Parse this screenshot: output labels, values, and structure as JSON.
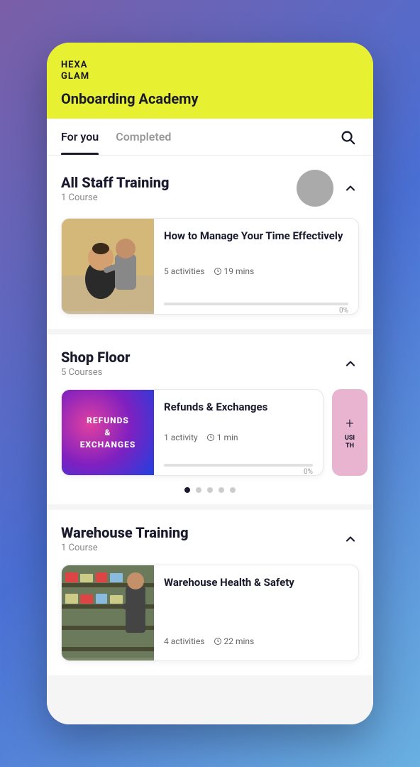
{
  "app": {
    "logo_line1": "HEXA",
    "logo_line2": "GLAM",
    "header_title": "Onboarding Academy"
  },
  "tabs": {
    "for_you": "For you",
    "completed": "Completed"
  },
  "sections": [
    {
      "id": "all-staff",
      "title": "All Staff Training",
      "subtitle": "1 Course",
      "show_avatar": true,
      "courses": [
        {
          "title": "How to Manage Your Time Effectively",
          "activities": "5 activities",
          "duration": "19 mins",
          "progress": 0,
          "thumb_type": "salon"
        }
      ]
    },
    {
      "id": "shop-floor",
      "title": "Shop Floor",
      "subtitle": "5 Courses",
      "show_avatar": false,
      "courses": [
        {
          "title": "Refunds & Exchanges",
          "activities": "1 activity",
          "duration": "1 min",
          "progress": 0,
          "thumb_type": "refunds",
          "thumb_text": "REFUNDS\n&\nEXCHANGES"
        }
      ],
      "carousel_dots": 5,
      "active_dot": 0
    },
    {
      "id": "warehouse",
      "title": "Warehouse Training",
      "subtitle": "1 Course",
      "show_avatar": false,
      "courses": [
        {
          "title": "Warehouse Health & Safety",
          "activities": "4 activities",
          "duration": "22 mins",
          "progress": 0,
          "thumb_type": "warehouse"
        }
      ]
    }
  ],
  "peek_card": {
    "plus": "+",
    "text": "USI\nTH"
  },
  "progress_label": "0%"
}
